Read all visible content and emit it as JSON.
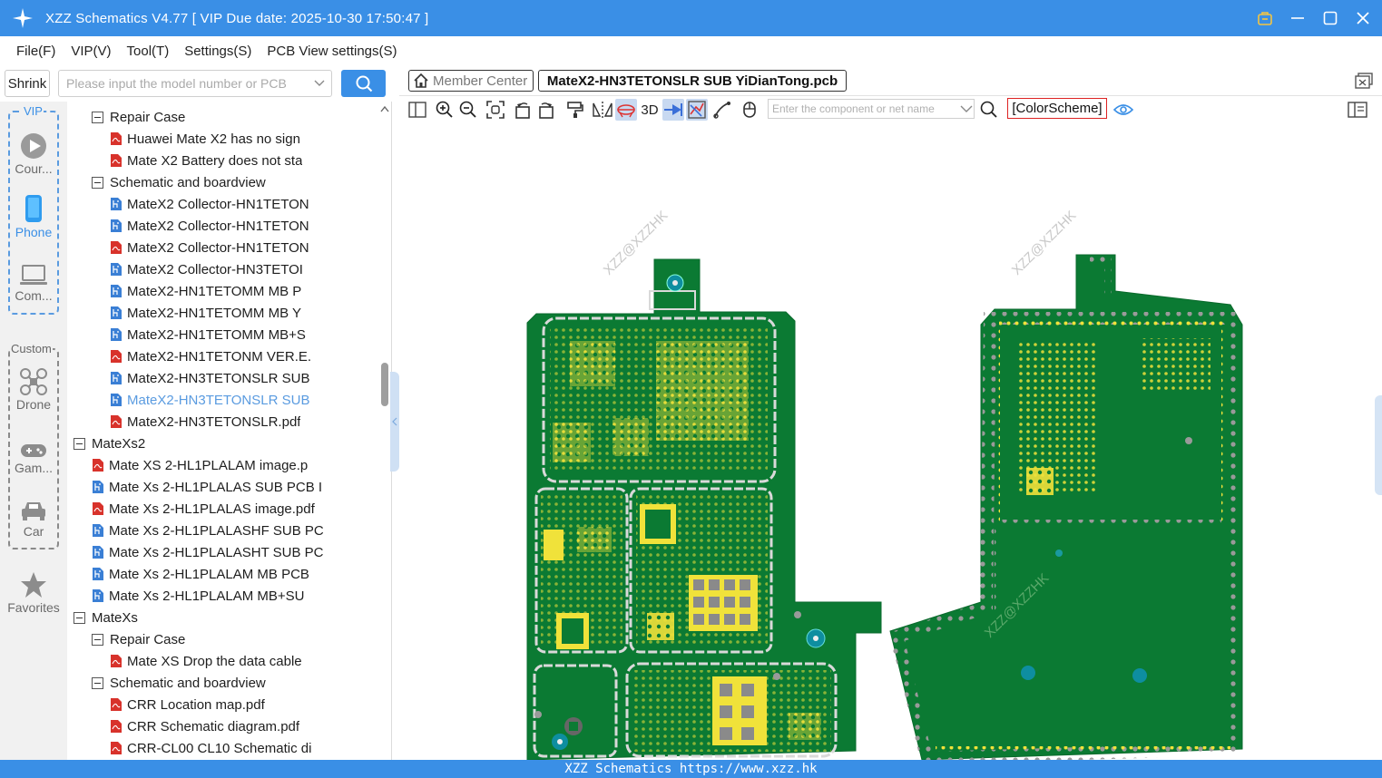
{
  "window": {
    "title": "XZZ Schematics V4.77 [ VIP Due date: 2025-10-30 17:50:47 ]",
    "accent_color": "#3a8fe6",
    "controls": [
      "vip-icon",
      "minimize-icon",
      "maximize-icon",
      "close-icon"
    ]
  },
  "menu": {
    "items": [
      "File(F)",
      "VIP(V)",
      "Tool(T)",
      "Settings(S)",
      "PCB View settings(S)"
    ]
  },
  "search": {
    "shrink_label": "Shrink",
    "placeholder": "Please input the model number or PCB",
    "button_icon": "search-icon"
  },
  "categories": {
    "vip_label": "VIP",
    "custom_label": "Custom",
    "vip_items": [
      {
        "label": "Cour...",
        "icon": "play-icon"
      },
      {
        "label": "Phone",
        "icon": "phone-icon",
        "active": true
      },
      {
        "label": "Com...",
        "icon": "laptop-icon"
      }
    ],
    "custom_items": [
      {
        "label": "Drone",
        "icon": "drone-icon"
      },
      {
        "label": "Gam...",
        "icon": "gamepad-icon"
      },
      {
        "label": "Car",
        "icon": "car-icon"
      }
    ],
    "favorites_label": "Favorites"
  },
  "tree": {
    "items": [
      {
        "level": 1,
        "type": "folder",
        "label": "Repair Case"
      },
      {
        "level": 2,
        "type": "pdf",
        "label": "Huawei Mate X2 has no sign"
      },
      {
        "level": 2,
        "type": "pdf",
        "label": "Mate X2 Battery does not sta"
      },
      {
        "level": 1,
        "type": "folder",
        "label": "Schematic and boardview"
      },
      {
        "level": 2,
        "type": "pcb",
        "label": "MateX2 Collector-HN1TETON"
      },
      {
        "level": 2,
        "type": "pcb",
        "label": "MateX2 Collector-HN1TETON"
      },
      {
        "level": 2,
        "type": "pdf",
        "label": "MateX2 Collector-HN1TETON"
      },
      {
        "level": 2,
        "type": "pcb",
        "label": "MateX2 Collector-HN3TETOI"
      },
      {
        "level": 2,
        "type": "pcb",
        "label": "MateX2-HN1TETOMM MB P"
      },
      {
        "level": 2,
        "type": "pcb",
        "label": "MateX2-HN1TETOMM MB Y"
      },
      {
        "level": 2,
        "type": "pcb",
        "label": "MateX2-HN1TETOMM MB+S"
      },
      {
        "level": 2,
        "type": "pdf",
        "label": "MateX2-HN1TETONM VER.E."
      },
      {
        "level": 2,
        "type": "pcb",
        "label": "MateX2-HN3TETONSLR SUB"
      },
      {
        "level": 2,
        "type": "pcb",
        "label": "MateX2-HN3TETONSLR SUB",
        "selected": true
      },
      {
        "level": 2,
        "type": "pdf",
        "label": "MateX2-HN3TETONSLR.pdf"
      },
      {
        "level": 0,
        "type": "folder",
        "label": "MateXs2"
      },
      {
        "level": 1,
        "type": "pdf",
        "label": "Mate XS 2-HL1PLALAM image.p"
      },
      {
        "level": 1,
        "type": "pcb",
        "label": "Mate Xs 2-HL1PLALAS SUB PCB I"
      },
      {
        "level": 1,
        "type": "pdf",
        "label": "Mate Xs 2-HL1PLALAS image.pdf"
      },
      {
        "level": 1,
        "type": "pcb",
        "label": "Mate Xs 2-HL1PLALASHF SUB PC"
      },
      {
        "level": 1,
        "type": "pcb",
        "label": "Mate Xs 2-HL1PLALASHT SUB PC"
      },
      {
        "level": 1,
        "type": "pcb",
        "label": "Mate Xs 2-HL1PLALAM MB PCB"
      },
      {
        "level": 1,
        "type": "pcb",
        "label": "Mate Xs 2-HL1PLALAM MB+SU"
      },
      {
        "level": 0,
        "type": "folder",
        "label": "MateXs"
      },
      {
        "level": 1,
        "type": "folder",
        "label": "Repair Case"
      },
      {
        "level": 2,
        "type": "pdf",
        "label": "Mate XS Drop the data cable"
      },
      {
        "level": 1,
        "type": "folder",
        "label": "Schematic and boardview"
      },
      {
        "level": 2,
        "type": "pdf",
        "label": "CRR Location map.pdf"
      },
      {
        "level": 2,
        "type": "pdf",
        "label": "CRR Schematic diagram.pdf"
      },
      {
        "level": 2,
        "type": "pdf",
        "label": "CRR-CL00 CL10 Schematic di"
      }
    ]
  },
  "tabs": {
    "member_center": "Member Center",
    "active_file": "MateX2-HN3TETONSLR SUB YiDianTong.pcb"
  },
  "toolbar": {
    "label_3d": "3D",
    "component_placeholder": "Enter the component or net name",
    "color_scheme": "[ColorScheme]",
    "accent_red": "#dd2222"
  },
  "canvas": {
    "watermark": "XZZ@XZZHK",
    "board_color": "#0b7a33",
    "pad_color": "#f0e23a",
    "trace_color": "#d9d9d9"
  },
  "status": {
    "text": "XZZ Schematics https://www.xzz.hk"
  }
}
